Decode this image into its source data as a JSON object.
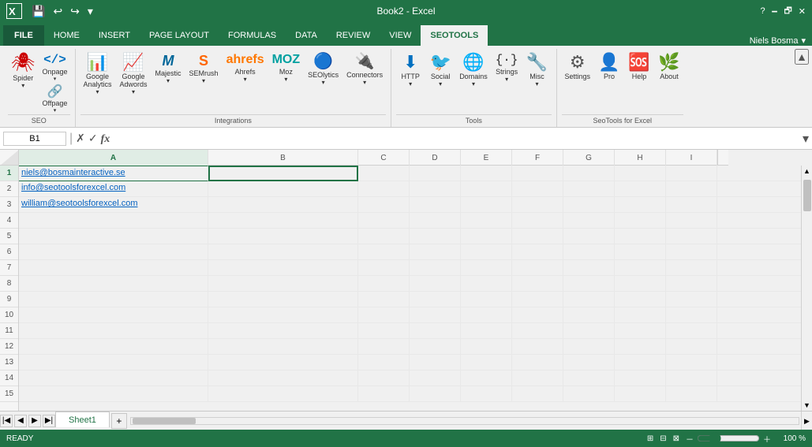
{
  "titleBar": {
    "title": "Book2 - Excel",
    "quickAccess": [
      "save",
      "undo",
      "redo",
      "customize"
    ]
  },
  "tabs": [
    {
      "id": "file",
      "label": "FILE"
    },
    {
      "id": "home",
      "label": "HOME"
    },
    {
      "id": "insert",
      "label": "INSERT"
    },
    {
      "id": "pagelayout",
      "label": "PAGE LAYOUT"
    },
    {
      "id": "formulas",
      "label": "FORMULAS"
    },
    {
      "id": "data",
      "label": "DATA"
    },
    {
      "id": "review",
      "label": "REVIEW"
    },
    {
      "id": "view",
      "label": "VIEW"
    },
    {
      "id": "seotools",
      "label": "SEOTOOLS"
    }
  ],
  "ribbon": {
    "groups": [
      {
        "label": "SEO",
        "items": [
          {
            "id": "spider",
            "label": "Spider",
            "icon": "🕷"
          },
          {
            "id": "onpage",
            "label": "Onpage",
            "icon": "</>"
          },
          {
            "id": "offpage",
            "label": "Offpage",
            "icon": "🔗"
          }
        ]
      },
      {
        "label": "Integrations",
        "items": [
          {
            "id": "google-analytics",
            "label": "Google\nAnalytics",
            "icon": "📊"
          },
          {
            "id": "google-adwords",
            "label": "Google\nAdwords",
            "icon": "📈"
          },
          {
            "id": "majestic",
            "label": "Majestic",
            "icon": "M"
          },
          {
            "id": "semrush",
            "label": "SEMrush",
            "icon": "S"
          },
          {
            "id": "ahrefs",
            "label": "Ahrefs",
            "icon": "a"
          },
          {
            "id": "moz",
            "label": "Moz",
            "icon": "M"
          },
          {
            "id": "seolytics",
            "label": "SEOlytics",
            "icon": "S"
          },
          {
            "id": "connectors",
            "label": "Connectors",
            "icon": "🔌"
          }
        ]
      },
      {
        "label": "Tools",
        "items": [
          {
            "id": "http",
            "label": "HTTP",
            "icon": "⬇"
          },
          {
            "id": "social",
            "label": "Social",
            "icon": "🐦"
          },
          {
            "id": "domains",
            "label": "Domains",
            "icon": "🌐"
          },
          {
            "id": "strings",
            "label": "Strings",
            "icon": "{·}"
          },
          {
            "id": "misc",
            "label": "Misc",
            "icon": "🔧"
          }
        ]
      },
      {
        "label": "SeoTools for Excel",
        "items": [
          {
            "id": "settings",
            "label": "Settings",
            "icon": "⚙"
          },
          {
            "id": "pro",
            "label": "Pro",
            "icon": "👤"
          },
          {
            "id": "help",
            "label": "Help",
            "icon": "🆘"
          },
          {
            "id": "about",
            "label": "About",
            "icon": "🌿"
          }
        ]
      }
    ]
  },
  "formulaBar": {
    "cellRef": "B1",
    "formula": "",
    "functionSymbol": "fx"
  },
  "cells": {
    "columns": [
      "A",
      "B",
      "C",
      "D",
      "E",
      "F",
      "G",
      "H",
      "I"
    ],
    "rows": [
      [
        "niels@bosmainteractive.se",
        "",
        "",
        "",
        "",
        "",
        "",
        "",
        ""
      ],
      [
        "info@seotoolsforexcel.com",
        "",
        "",
        "",
        "",
        "",
        "",
        "",
        ""
      ],
      [
        "william@seotoolsforexcel.com",
        "",
        "",
        "",
        "",
        "",
        "",
        "",
        ""
      ],
      [
        "",
        "",
        "",
        "",
        "",
        "",
        "",
        "",
        ""
      ],
      [
        "",
        "",
        "",
        "",
        "",
        "",
        "",
        "",
        ""
      ],
      [
        "",
        "",
        "",
        "",
        "",
        "",
        "",
        "",
        ""
      ],
      [
        "",
        "",
        "",
        "",
        "",
        "",
        "",
        "",
        ""
      ],
      [
        "",
        "",
        "",
        "",
        "",
        "",
        "",
        "",
        ""
      ],
      [
        "",
        "",
        "",
        "",
        "",
        "",
        "",
        "",
        ""
      ],
      [
        "",
        "",
        "",
        "",
        "",
        "",
        "",
        "",
        ""
      ],
      [
        "",
        "",
        "",
        "",
        "",
        "",
        "",
        "",
        ""
      ],
      [
        "",
        "",
        "",
        "",
        "",
        "",
        "",
        "",
        ""
      ],
      [
        "",
        "",
        "",
        "",
        "",
        "",
        "",
        "",
        ""
      ],
      [
        "",
        "",
        "",
        "",
        "",
        "",
        "",
        "",
        ""
      ],
      [
        "",
        "",
        "",
        "",
        "",
        "",
        "",
        "",
        ""
      ]
    ],
    "rowNumbers": [
      1,
      2,
      3,
      4,
      5,
      6,
      7,
      8,
      9,
      10,
      11,
      12,
      13,
      14,
      15
    ]
  },
  "sheetTabs": [
    {
      "label": "Sheet1",
      "active": true
    }
  ],
  "statusBar": {
    "status": "READY",
    "zoom": "100 %"
  },
  "user": {
    "name": "Niels Bosma"
  }
}
